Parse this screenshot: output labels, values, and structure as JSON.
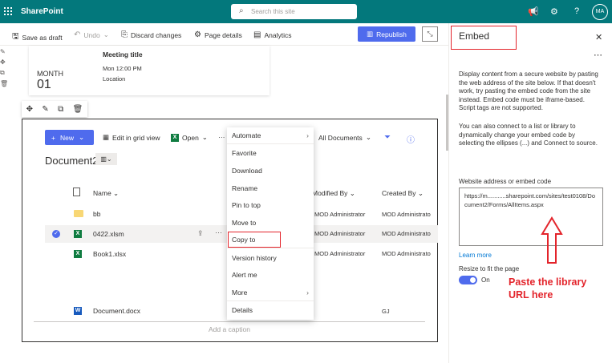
{
  "topbar": {
    "app_name": "SharePoint",
    "search_placeholder": "Search this site",
    "avatar": "MA"
  },
  "commandbar": {
    "save_as_draft": "Save as draft",
    "undo": "Undo",
    "discard": "Discard changes",
    "page_details": "Page details",
    "analytics": "Analytics",
    "republish": "Republish"
  },
  "event": {
    "month": "MONTH",
    "day": "01",
    "title": "Meeting title",
    "time": "Mon 12:00 PM",
    "location": "Location"
  },
  "library": {
    "new_label": "New",
    "edit_grid": "Edit in grid view",
    "open": "Open",
    "view_name": "All Documents",
    "title": "Document2",
    "columns": {
      "name": "Name",
      "modified_by": "Modified By",
      "created_by": "Created By"
    },
    "rows": [
      {
        "name": "bb",
        "modified_by": "MOD Administrator",
        "created_by": "MOD Administrato"
      },
      {
        "name": "0422.xlsm",
        "modified_by": "MOD Administrator",
        "created_by": "MOD Administrato"
      },
      {
        "name": "Book1.xlsx",
        "modified_by": "MOD Administrator",
        "created_by": "MOD Administrato"
      },
      {
        "name": "Document.docx",
        "modified_by": "",
        "created_by": "GJ"
      }
    ],
    "caption_placeholder": "Add a caption"
  },
  "context_menu": {
    "items": [
      "Automate",
      "Favorite",
      "Download",
      "Rename",
      "Pin to top",
      "Move to",
      "Copy to",
      "Version history",
      "Alert me",
      "More",
      "Details"
    ]
  },
  "panel": {
    "title": "Embed",
    "description": "Display content from a secure website by pasting the web address of the site below. If that doesn't work, try pasting the embed code from the site instead. Embed code must be iframe-based. Script tags are not supported.",
    "description2": "You can also connect to a list or library to dynamically change your embed code by selecting the ellipses (...) and Connect to source.",
    "field_label": "Website address or embed code",
    "field_value": "https://m...........sharepoint.com/sites/test0108/Document2/Forms/AllItems.aspx",
    "learn_more": "Learn more",
    "resize_label": "Resize to fit the page",
    "toggle_state": "On"
  },
  "annotation": {
    "line1": "Paste the library",
    "line2": "URL here"
  },
  "colors": {
    "brand": "#03787c",
    "accent": "#4f6bed",
    "highlight": "#e3242b"
  }
}
